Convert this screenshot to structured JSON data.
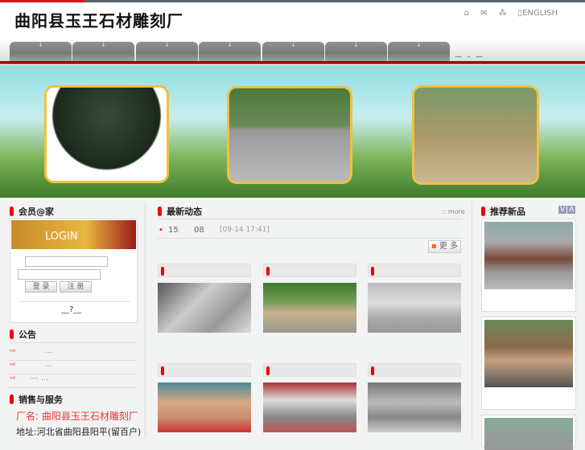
{
  "header": {
    "logo": "曲阳县玉王石材雕刻厂",
    "english": "ENGLISH",
    "icons": [
      "home-icon",
      "mail-icon",
      "sitemap-icon",
      "book-icon"
    ]
  },
  "nav": {
    "tabs": [
      "",
      "",
      "",
      "",
      "",
      "",
      ""
    ],
    "extra": "— - —"
  },
  "member": {
    "title": "会员@家",
    "login_banner": "LOGIN",
    "login_button": "登 录",
    "register_button": "注 册",
    "forgot": "__?__"
  },
  "notice": {
    "title": "公告",
    "items": [
      "…",
      "…",
      "--- …"
    ]
  },
  "sales": {
    "title": "销售与服务",
    "factory": "厂名: 曲阳县玉王石材雕刻厂",
    "address": "地址:河北省曲阳县阳平(留百户)"
  },
  "news": {
    "title": "最新动态",
    "more": ":: more",
    "item": {
      "a": "15",
      "b": "08",
      "date": "[09-14 17:41]"
    },
    "more_button": "更 多"
  },
  "recommend": {
    "title": "推荐新品",
    "nav": [
      "V",
      "A"
    ]
  }
}
